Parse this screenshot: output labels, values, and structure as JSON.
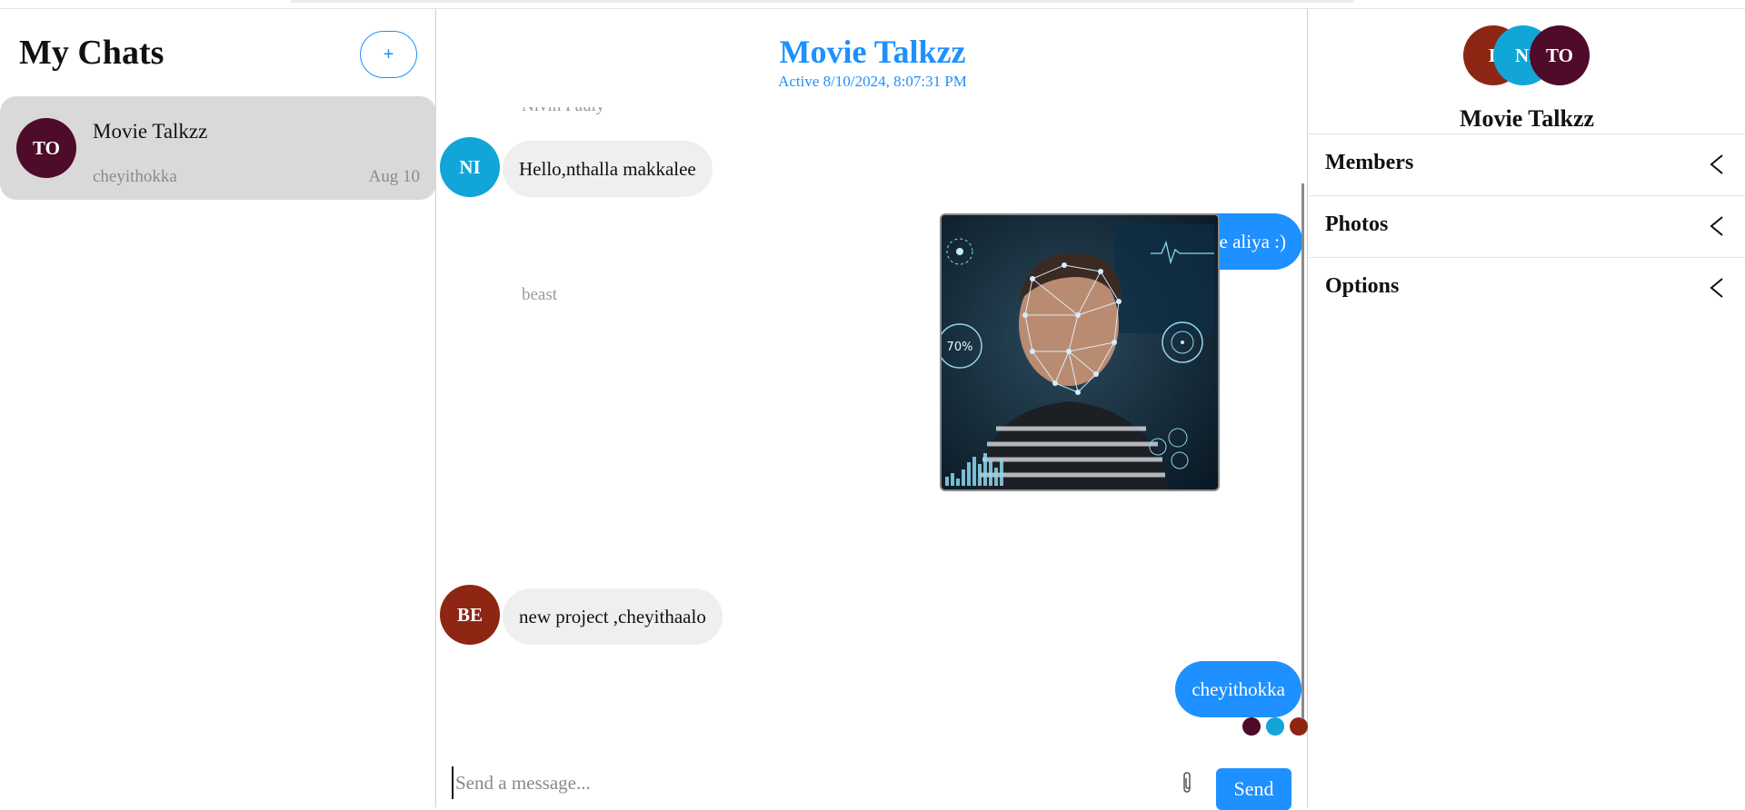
{
  "left": {
    "title": "My Chats",
    "new_button": "+",
    "chats": [
      {
        "initials": "TO",
        "name": "Movie Talkzz",
        "last_message": "cheyithokka",
        "date": "Aug 10",
        "color": "#4f0b2a"
      }
    ]
  },
  "chat": {
    "title": "Movie Talkzz",
    "status": "Active 8/10/2024, 8:07:31 PM",
    "messages": [
      {
        "sender": "Nivin Pauly",
        "initials": "NI",
        "text": "Hello,nthalla makkalee",
        "color": "#12a5d8",
        "direction": "in"
      },
      {
        "text": "Sugham thanne aliya :)",
        "direction": "out"
      },
      {
        "sender": "beast",
        "type": "image",
        "image_alt": "Face recognition image",
        "photo_badge": "70%",
        "direction": "in"
      },
      {
        "initials": "BE",
        "text": "new project ,cheyithaalo",
        "color": "#8e2614",
        "direction": "in"
      },
      {
        "text": "cheyithokka",
        "direction": "out"
      }
    ],
    "read_receipt_colors": [
      "#4f0b2a",
      "#12a5d8",
      "#8e2614"
    ],
    "composer_placeholder": "Send a message...",
    "send_label": "Send",
    "attach_icon": "paperclip-icon"
  },
  "details": {
    "avatars": [
      {
        "initials": "BE",
        "color": "#8e2614"
      },
      {
        "initials": "NI",
        "color": "#12a5d8"
      },
      {
        "initials": "TO",
        "color": "#4f0b2a"
      }
    ],
    "group_name": "Movie Talkzz",
    "sections": [
      "Members",
      "Photos",
      "Options"
    ]
  },
  "colors": {
    "accent": "#1e90ff",
    "incoming_bubble": "#efefef",
    "selected_chat": "#d9d9d9"
  }
}
